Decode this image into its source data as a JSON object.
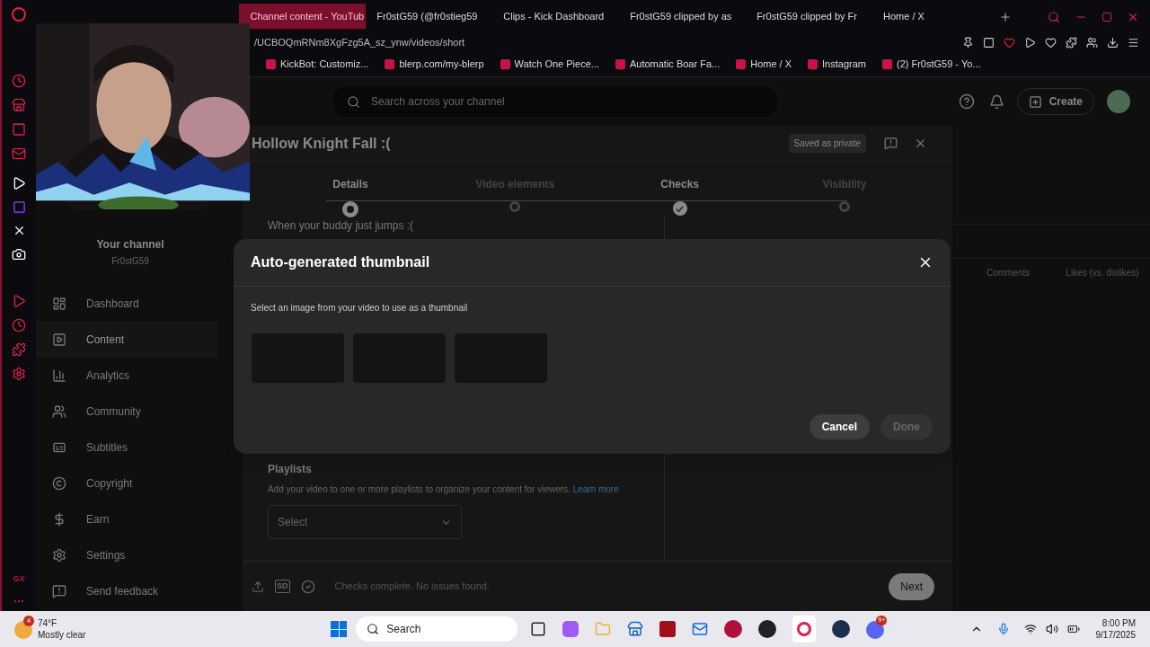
{
  "browser": {
    "tabs": [
      {
        "label": "Channel content - YouTub",
        "selected": true
      },
      {
        "label": "Fr0stG59 (@fr0stieg59",
        "selected": false
      },
      {
        "label": "Clips - Kick Dashboard",
        "selected": false
      },
      {
        "label": "Fr0stG59 clipped by as",
        "selected": false
      },
      {
        "label": "Fr0stG59 clipped by Fr",
        "selected": false
      },
      {
        "label": "Home / X",
        "selected": false
      }
    ],
    "address": "/UCBOQmRNm8XgFzg5A_sz_ynw/videos/short",
    "bookmarks": [
      "KickBot: Customiz...",
      "blerp.com/my-blerp",
      "Watch One Piece...",
      "Automatic Boar Fa...",
      "Home / X",
      "Instagram",
      "(2) Fr0stG59 - Yo..."
    ],
    "sidebar_label": "GX"
  },
  "header": {
    "search": {
      "placeholder": "Search across your channel"
    },
    "create": "Create"
  },
  "sidebar": {
    "channel_title": "Your channel",
    "channel_name": "Fr0stG59",
    "items": [
      {
        "label": "Dashboard",
        "selected": false
      },
      {
        "label": "Content",
        "selected": true
      },
      {
        "label": "Analytics",
        "selected": false
      },
      {
        "label": "Community",
        "selected": false
      },
      {
        "label": "Subtitles",
        "selected": false
      },
      {
        "label": "Copyright",
        "selected": false
      },
      {
        "label": "Earn",
        "selected": false
      },
      {
        "label": "Settings",
        "selected": false
      },
      {
        "label": "Send feedback",
        "selected": false
      }
    ]
  },
  "upload_dialog": {
    "title": "Hollow Knight Fall :(",
    "status": "Saved as private",
    "steps": [
      {
        "label": "Details",
        "current": true,
        "completed": false
      },
      {
        "label": "Video elements",
        "current": false,
        "completed": false
      },
      {
        "label": "Checks",
        "current": false,
        "completed": true
      },
      {
        "label": "Visibility",
        "current": false,
        "completed": false
      }
    ],
    "description": "When your buddy just jumps :(",
    "playlists": {
      "heading": "Playlists",
      "help": "Add your video to one or more playlists to organize your content for viewers.",
      "link": "Learn more",
      "select": "Select"
    },
    "footer": {
      "badge": "SD",
      "status": "Checks complete. No issues found.",
      "next": "Next"
    }
  },
  "table": {
    "columns": [
      "Comments",
      "Likes (vs. dislikes)"
    ]
  },
  "modal": {
    "title": "Auto-generated thumbnail",
    "prompt": "Select an image from your video to use as a thumbnail",
    "thumbnails": [
      {
        "selected": false
      },
      {
        "selected": false
      },
      {
        "selected": false
      }
    ],
    "cancel": "Cancel",
    "done": {
      "label": "Done",
      "disabled": true
    }
  },
  "taskbar": {
    "weather_badge": "4",
    "temperature": "74°F",
    "weather": "Mostly clear",
    "search": "Search",
    "discord_badge": "9+",
    "time": "8:00 PM",
    "date": "9/17/2025"
  }
}
